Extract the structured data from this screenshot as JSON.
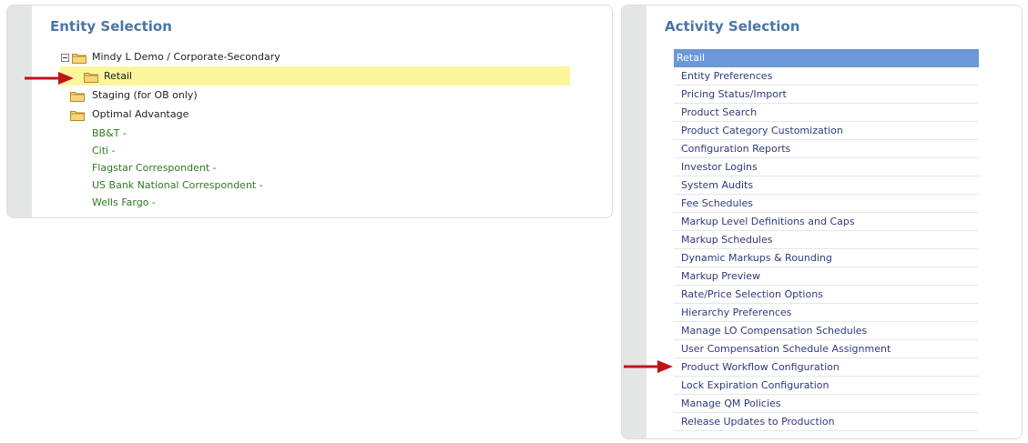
{
  "entity_panel": {
    "title": "Entity Selection",
    "root": {
      "label": "Mindy L Demo / Corporate-Secondary",
      "children": [
        {
          "label": "Retail",
          "selected": true
        },
        {
          "label": "Staging (for OB only)"
        },
        {
          "label": "Optimal Advantage"
        }
      ]
    },
    "correspondents": [
      "BB&T -",
      "Citi -",
      "Flagstar Correspondent -",
      "US Bank National Correspondent -",
      "Wells Fargo -"
    ]
  },
  "activity_panel": {
    "title": "Activity Selection",
    "header": "Retail",
    "items": [
      "Entity Preferences",
      "Pricing Status/Import",
      "Product Search",
      "Product Category Customization",
      "Configuration Reports",
      "Investor Logins",
      "System Audits",
      "Fee Schedules",
      "Markup Level Definitions and Caps",
      "Markup Schedules",
      "Dynamic Markups & Rounding",
      "Markup Preview",
      "Rate/Price Selection Options",
      "Hierarchy Preferences",
      "Manage LO Compensation Schedules",
      "User Compensation Schedule Assignment",
      "Product Workflow Configuration",
      "Lock Expiration Configuration",
      "Manage QM Policies",
      "Release Updates to Production"
    ]
  },
  "colors": {
    "title": "#4a75a6",
    "highlight": "#fbf69b",
    "selected_header": "#6a98d8",
    "link": "#2f3a7a",
    "correspondent": "#2d7a1e",
    "arrow": "#c0141b"
  },
  "icons": [
    "folder-icon",
    "collapse-icon",
    "pointer-arrow-icon"
  ]
}
